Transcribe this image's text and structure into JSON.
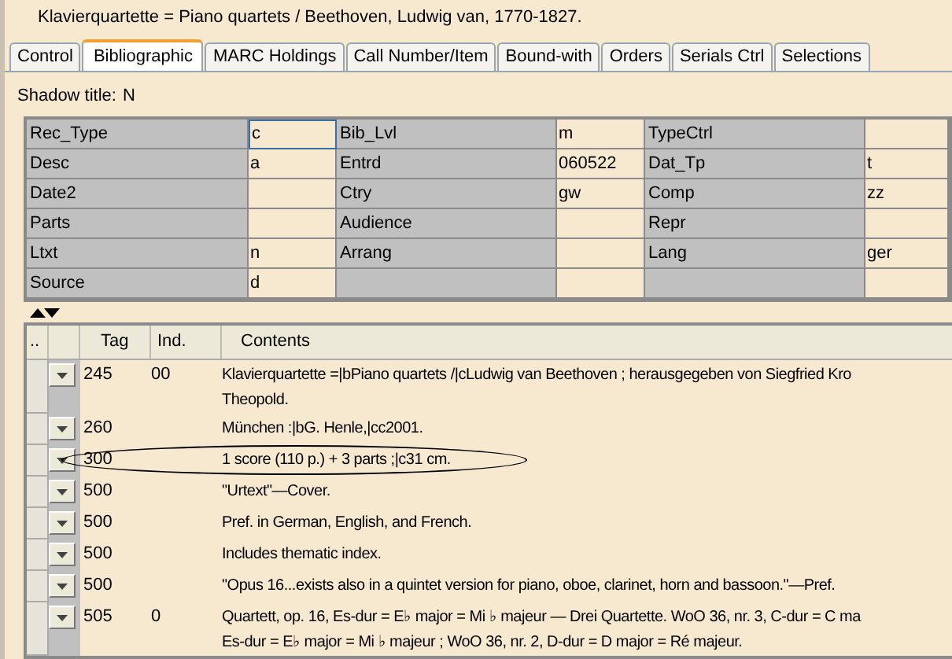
{
  "header": {
    "title": "Klavierquartette = Piano quartets / Beethoven, Ludwig van, 1770-1827."
  },
  "tabs": [
    {
      "label": "Control",
      "selected": false
    },
    {
      "label": "Bibliographic",
      "selected": true
    },
    {
      "label": "MARC Holdings",
      "selected": false
    },
    {
      "label": "Call Number/Item",
      "selected": false
    },
    {
      "label": "Bound-with",
      "selected": false
    },
    {
      "label": "Orders",
      "selected": false
    },
    {
      "label": "Serials Ctrl",
      "selected": false
    },
    {
      "label": "Selections",
      "selected": false
    }
  ],
  "shadow_title": {
    "label": "Shadow title:",
    "value": "N"
  },
  "fixed_fields": [
    [
      {
        "label": "Rec_Type",
        "value": "c",
        "focused": true
      },
      {
        "label": "Bib_Lvl",
        "value": "m",
        "focused": false
      },
      {
        "label": "TypeCtrl",
        "focused": false
      }
    ],
    [
      {
        "label": "Desc",
        "value": "a",
        "focused": false
      },
      {
        "label": "Entrd",
        "value": "060522",
        "focused": false
      },
      {
        "label": "Dat_Tp",
        "value": "t",
        "focused": false
      }
    ],
    [
      {
        "label": "Date2",
        "focused": false
      },
      {
        "label": "Ctry",
        "value": "gw",
        "focused": false
      },
      {
        "label": "Comp",
        "value": "zz",
        "focused": false
      }
    ],
    [
      {
        "label": "Parts",
        "focused": false
      },
      {
        "label": "Audience",
        "focused": false
      },
      {
        "label": "Repr",
        "focused": false
      }
    ],
    [
      {
        "label": "Ltxt",
        "value": "n",
        "focused": false
      },
      {
        "label": "Arrang",
        "focused": false
      },
      {
        "label": "Lang",
        "value": "ger",
        "focused": false
      }
    ],
    [
      {
        "label": "Source",
        "value": "d",
        "focused": false
      }
    ]
  ],
  "table": {
    "columns": [
      "..",
      "Tag",
      "Ind.",
      "Contents"
    ],
    "rows": [
      {
        "tag": "245",
        "ind": "00",
        "lines": [
          "Klavierquartette =|bPiano quartets /|cLudwig van Beethoven ; herausgegeben von Siegfried Kro",
          "Theopold."
        ],
        "circled": false
      },
      {
        "tag": "260",
        "lines": [
          "München :|bG. Henle,|cc2001."
        ],
        "circled": false
      },
      {
        "tag": "300",
        "lines": [
          "1 score (110 p.) + 3 parts ;|c31 cm."
        ],
        "circled": true
      },
      {
        "tag": "500",
        "lines": [
          "\"Urtext\"—Cover."
        ],
        "circled": false
      },
      {
        "tag": "500",
        "lines": [
          "Pref. in German, English, and French."
        ],
        "circled": false
      },
      {
        "tag": "500",
        "lines": [
          "Includes thematic index."
        ],
        "circled": false
      },
      {
        "tag": "500",
        "lines": [
          "\"Opus 16...exists also in a quintet version for piano, oboe, clarinet, horn and bassoon.\"—Pref."
        ],
        "circled": false
      },
      {
        "tag": "505",
        "ind": "0",
        "lines": [
          "Quartett, op. 16, Es-dur = E♭ major = Mi ♭ majeur — Drei Quartette. WoO 36, nr. 3, C-dur = C ma",
          "Es-dur = E♭ major = Mi ♭ majeur ; WoO 36, nr. 2, D-dur = D major = Ré majeur."
        ],
        "circled": false
      }
    ]
  }
}
